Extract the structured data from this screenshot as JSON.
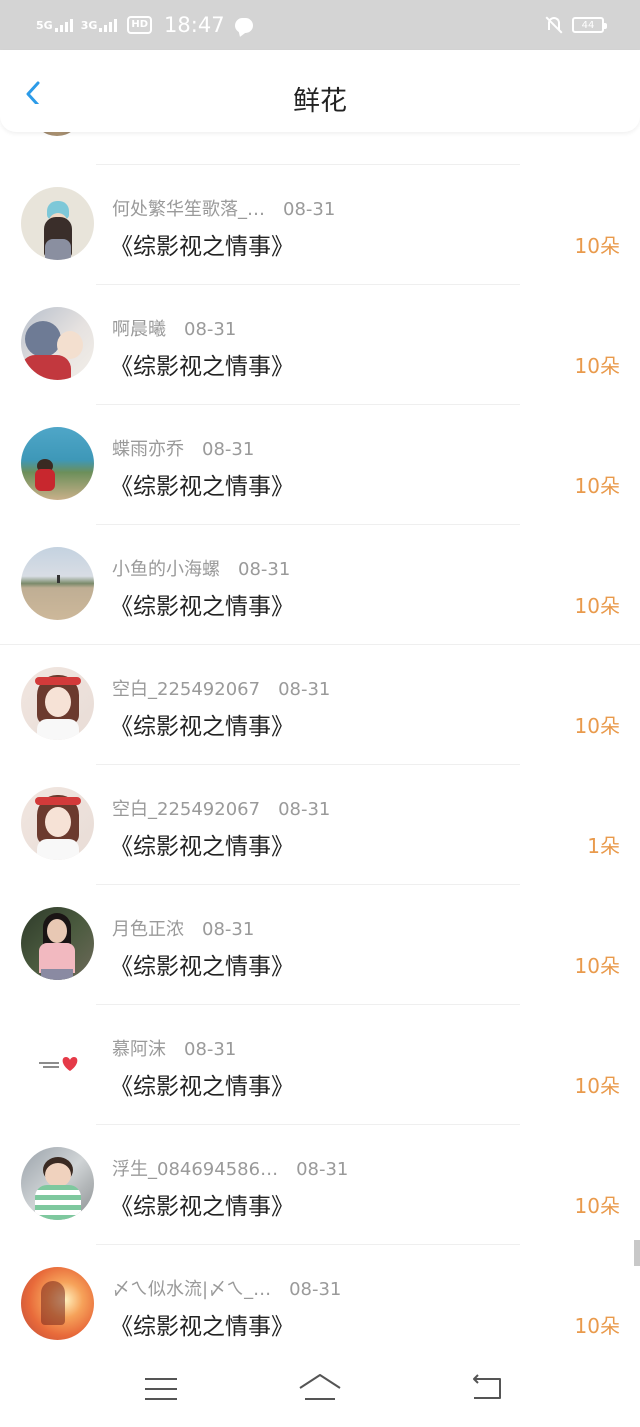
{
  "status": {
    "net1": "5G",
    "net2": "3G",
    "hd": "HD",
    "time": "18:47",
    "battery": "44"
  },
  "header": {
    "title": "鲜花"
  },
  "items": [
    {
      "user": "何处繁华笙歌落_…",
      "date": "08-31",
      "title": "《综影视之情事》",
      "qty": "10朵"
    },
    {
      "user": "啊晨曦",
      "date": "08-31",
      "title": "《综影视之情事》",
      "qty": "10朵"
    },
    {
      "user": "蝶雨亦乔",
      "date": "08-31",
      "title": "《综影视之情事》",
      "qty": "10朵"
    },
    {
      "user": "小鱼的小海螺",
      "date": "08-31",
      "title": "《综影视之情事》",
      "qty": "10朵"
    },
    {
      "user": "空白_225492067",
      "date": "08-31",
      "title": "《综影视之情事》",
      "qty": "10朵"
    },
    {
      "user": "空白_225492067",
      "date": "08-31",
      "title": "《综影视之情事》",
      "qty": "1朵"
    },
    {
      "user": "月色正浓",
      "date": "08-31",
      "title": "《综影视之情事》",
      "qty": "10朵"
    },
    {
      "user": "慕阿沫",
      "date": "08-31",
      "title": "《综影视之情事》",
      "qty": "10朵"
    },
    {
      "user": "浮生_084694586…",
      "date": "08-31",
      "title": "《综影视之情事》",
      "qty": "10朵"
    },
    {
      "user": "〆ㄟ似水流|〆ㄟ_…",
      "date": "08-31",
      "title": "《综影视之情事》",
      "qty": "10朵"
    }
  ],
  "colors": {
    "accent": "#e99a4c",
    "back": "#2c9be8"
  }
}
